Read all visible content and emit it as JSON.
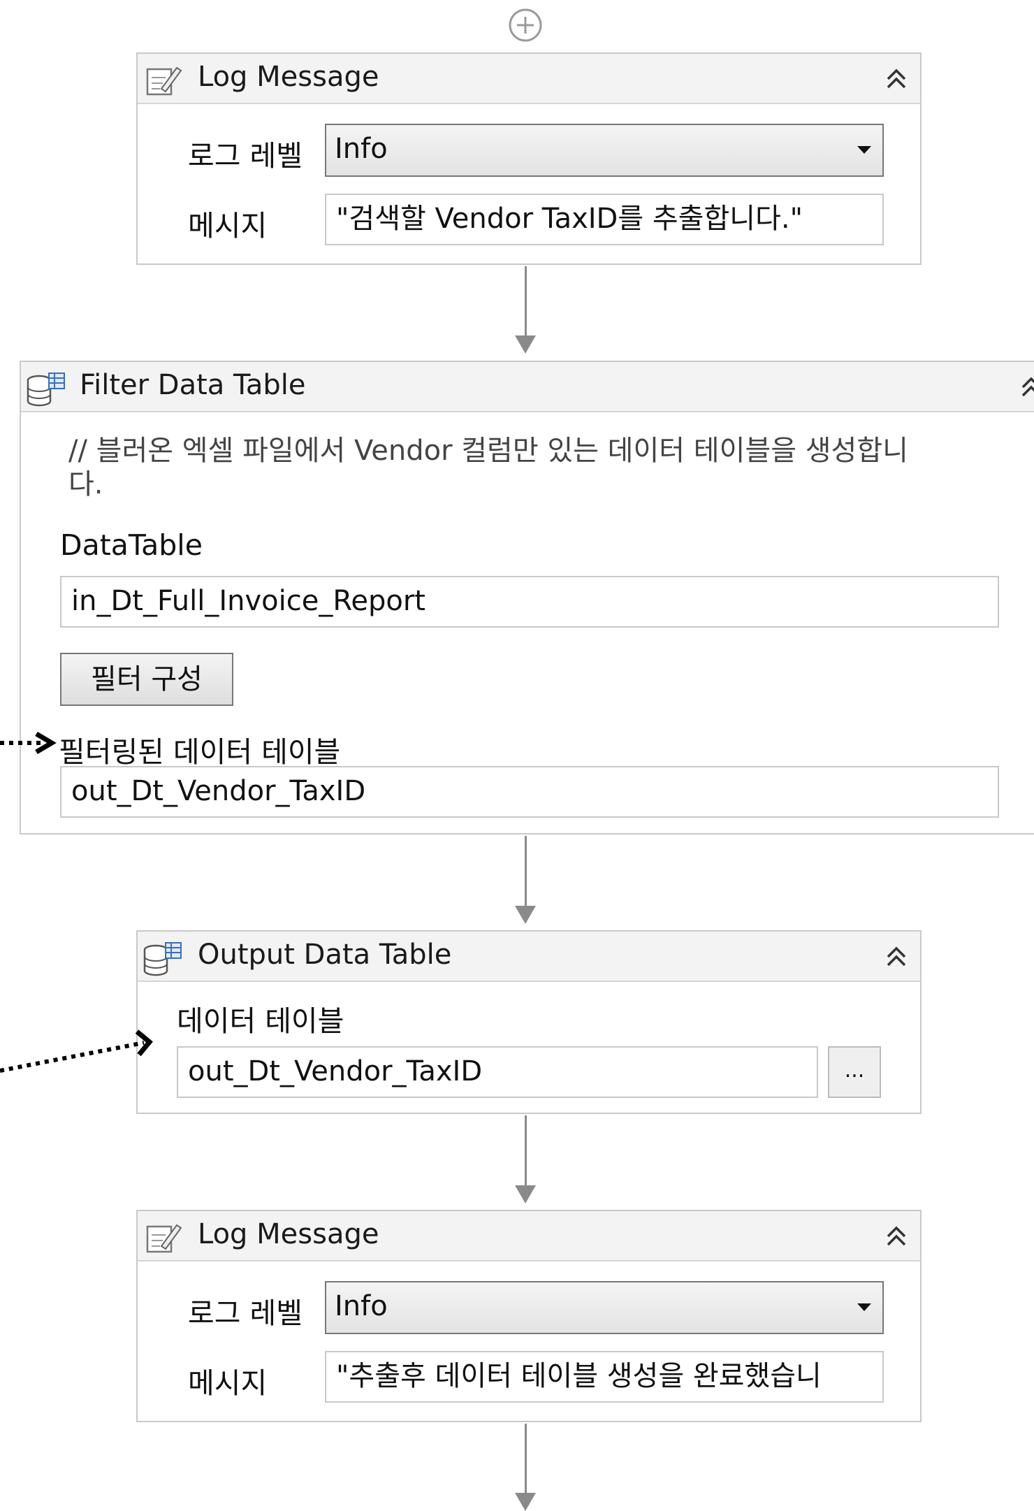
{
  "add_button_icon": "plus-circle-icon",
  "log_message_1": {
    "title": "Log Message",
    "icon": "log-message-icon",
    "log_level_label": "로그 레벨",
    "log_level_value": "Info",
    "message_label": "메시지",
    "message_value": "\"검색할 Vendor TaxID를 추출합니다.\""
  },
  "filter_data_table": {
    "title": "Filter Data Table",
    "icon": "data-table-icon",
    "comment_line1": "// 블러온 엑셀 파일에서 Vendor 컬럼만 있는 데이터 테이블을 생성합니",
    "comment_line2": "다.",
    "datatable_label": "DataTable",
    "datatable_value": "in_Dt_Full_Invoice_Report",
    "configure_button": "필터 구성",
    "filtered_label": "필터링된 데이터 테이블",
    "filtered_value": "out_Dt_Vendor_TaxID"
  },
  "output_data_table": {
    "title": "Output Data Table",
    "icon": "data-table-icon",
    "datatable_label": "데이터 테이블",
    "datatable_value": "out_Dt_Vendor_TaxID",
    "browse_button": "..."
  },
  "log_message_2": {
    "title": "Log Message",
    "icon": "log-message-icon",
    "log_level_label": "로그 레벨",
    "log_level_value": "Info",
    "message_label": "메시지",
    "message_value": "\"추출후 데이터 테이블 생성을 완료했습니"
  },
  "colors": {
    "header_bg": "#f3f3f3",
    "border": "#c9c9c9",
    "connector": "#8a8a8a",
    "annotation_arrow": "#000000"
  }
}
